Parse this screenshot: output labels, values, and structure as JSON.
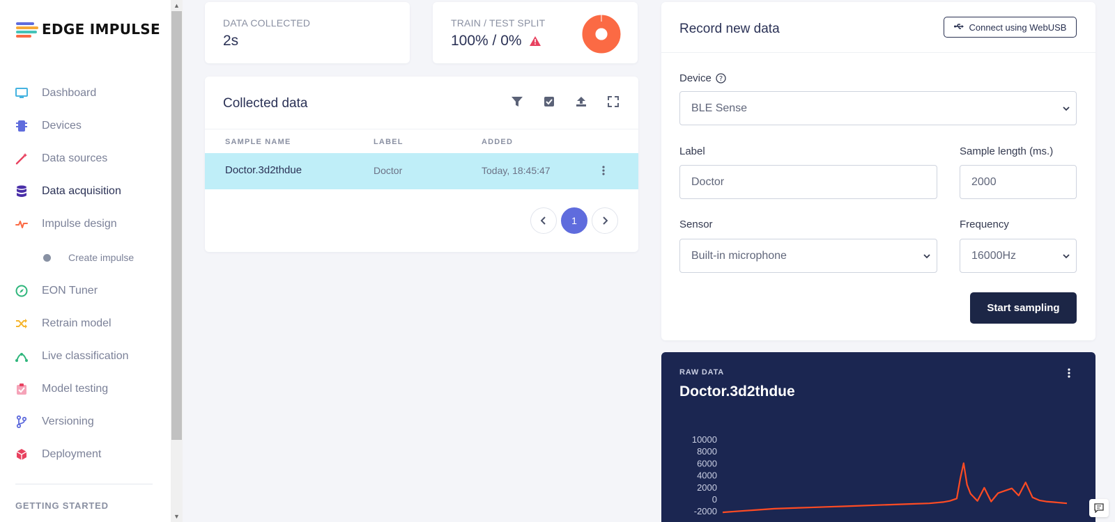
{
  "brand": {
    "name": "EDGE IMPULSE"
  },
  "sidebar": {
    "items": [
      {
        "label": "Dashboard",
        "icon": "monitor-icon"
      },
      {
        "label": "Devices",
        "icon": "chip-icon"
      },
      {
        "label": "Data sources",
        "icon": "wand-icon"
      },
      {
        "label": "Data acquisition",
        "icon": "database-icon"
      },
      {
        "label": "Impulse design",
        "icon": "pulse-icon"
      },
      {
        "label": "EON Tuner",
        "icon": "compass-icon"
      },
      {
        "label": "Retrain model",
        "icon": "shuffle-icon"
      },
      {
        "label": "Live classification",
        "icon": "curve-icon"
      },
      {
        "label": "Model testing",
        "icon": "clipboard-check-icon"
      },
      {
        "label": "Versioning",
        "icon": "git-branch-icon"
      },
      {
        "label": "Deployment",
        "icon": "cube-icon"
      }
    ],
    "subitem": {
      "label": "Create impulse"
    },
    "section_heading": "GETTING STARTED",
    "active": "Data acquisition"
  },
  "stats": {
    "data_collected": {
      "label": "DATA COLLECTED",
      "value": "2s"
    },
    "split": {
      "label": "TRAIN / TEST SPLIT",
      "value": "100% / 0%",
      "train_fraction": 1.0
    }
  },
  "collected": {
    "title": "Collected data",
    "columns": [
      "SAMPLE NAME",
      "LABEL",
      "ADDED"
    ],
    "rows": [
      {
        "name": "Doctor.3d2thdue",
        "label": "Doctor",
        "added": "Today, 18:45:47"
      }
    ],
    "pagination": {
      "current": "1"
    }
  },
  "record": {
    "title": "Record new data",
    "webusb_label": "Connect using WebUSB",
    "device": {
      "label": "Device",
      "value": "BLE Sense"
    },
    "label_field": {
      "label": "Label",
      "value": "Doctor"
    },
    "sample_length": {
      "label": "Sample length (ms.)",
      "value": "2000"
    },
    "sensor": {
      "label": "Sensor",
      "value": "Built-in microphone"
    },
    "frequency": {
      "label": "Frequency",
      "value": "16000Hz"
    },
    "start_label": "Start sampling"
  },
  "raw": {
    "label": "RAW DATA",
    "title": "Doctor.3d2thdue"
  },
  "colors": {
    "accent": "#5f6cdd",
    "highlight_row": "#bfeef8",
    "dark_button": "#1c2646",
    "raw_bg": "#1b2651",
    "waveform": "#ff4b23",
    "split_donut": "#fb6a44"
  },
  "chart_data": {
    "type": "line",
    "title": "",
    "xlabel": "",
    "ylabel": "",
    "y_ticks": [
      "10000",
      "8000",
      "6000",
      "4000",
      "2000",
      "0",
      "-2000"
    ],
    "ylim": [
      -4000,
      10000
    ],
    "grid": false,
    "series": [
      {
        "x": [
          0,
          0.05,
          0.1,
          0.15,
          0.2,
          0.25,
          0.3,
          0.35,
          0.4,
          0.45,
          0.5,
          0.55,
          0.6,
          0.62,
          0.64,
          0.66,
          0.68,
          0.69,
          0.7,
          0.71,
          0.72,
          0.74,
          0.76,
          0.78,
          0.8,
          0.82,
          0.84,
          0.86,
          0.88,
          0.9,
          0.92,
          0.94,
          0.96,
          0.98,
          1.0
        ],
        "y": [
          -2100,
          -1900,
          -1700,
          -1500,
          -1400,
          -1300,
          -1200,
          -1100,
          -1000,
          -900,
          -800,
          -700,
          -600,
          -500,
          -400,
          -200,
          200,
          3500,
          6100,
          2500,
          1000,
          -200,
          2000,
          -300,
          1100,
          1500,
          1900,
          700,
          2900,
          400,
          -100,
          -300,
          -400,
          -500,
          -600
        ]
      }
    ]
  }
}
